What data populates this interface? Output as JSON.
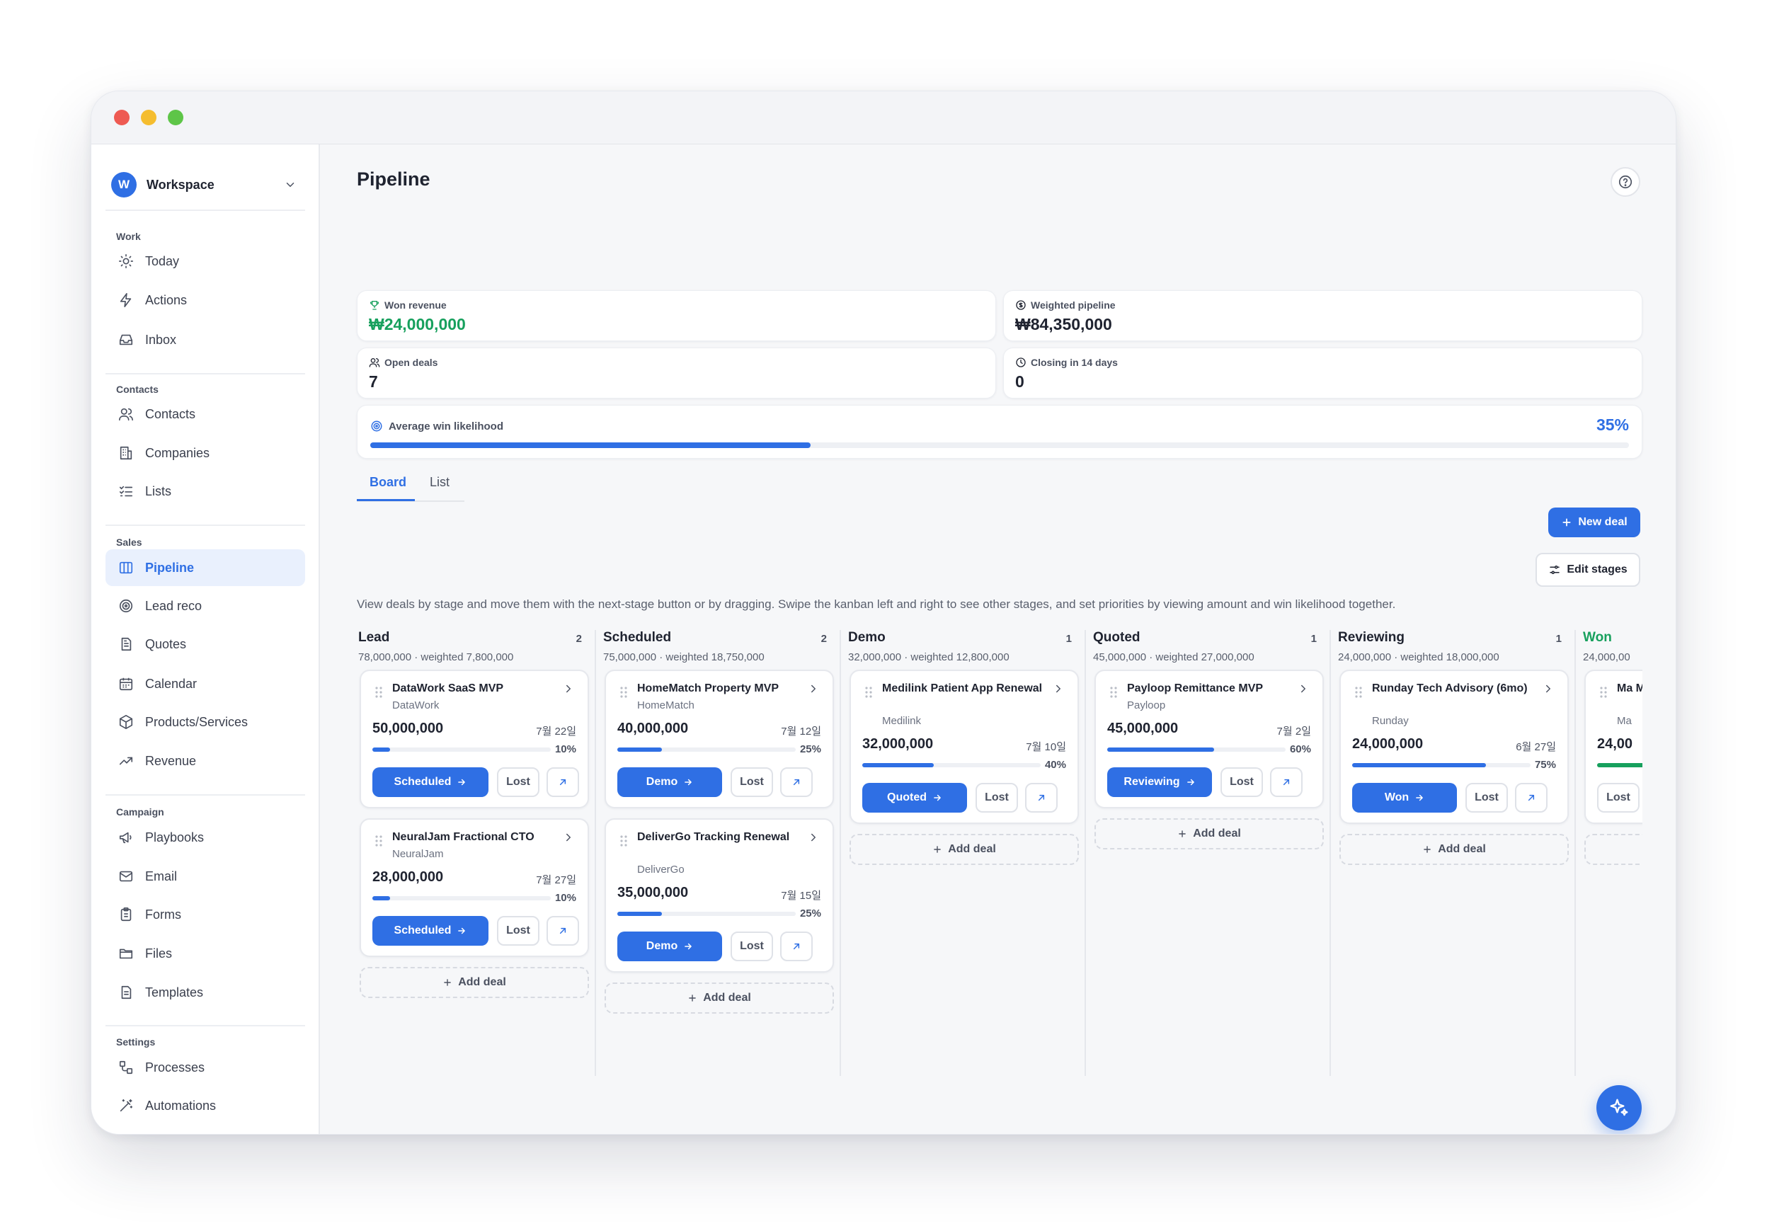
{
  "workspace": {
    "initial": "W",
    "name": "Workspace"
  },
  "sidebar": {
    "sections": {
      "work": "Work",
      "contacts": "Contacts",
      "sales": "Sales",
      "campaign": "Campaign",
      "settings": "Settings"
    },
    "items": {
      "today": "Today",
      "actions": "Actions",
      "inbox": "Inbox",
      "contacts": "Contacts",
      "companies": "Companies",
      "lists": "Lists",
      "pipeline": "Pipeline",
      "lead_reco": "Lead reco",
      "quotes": "Quotes",
      "calendar": "Calendar",
      "products": "Products/Services",
      "revenue": "Revenue",
      "playbooks": "Playbooks",
      "email": "Email",
      "forms": "Forms",
      "files": "Files",
      "templates": "Templates",
      "processes": "Processes",
      "automations": "Automations"
    }
  },
  "page": {
    "title": "Pipeline"
  },
  "stats": {
    "won_revenue": {
      "label": "Won revenue",
      "value": "₩24,000,000"
    },
    "weighted_pipeline": {
      "label": "Weighted pipeline",
      "value": "₩84,350,000"
    },
    "open_deals": {
      "label": "Open deals",
      "value": "7"
    },
    "closing": {
      "label": "Closing in 14 days",
      "value": "0"
    }
  },
  "likelihood": {
    "label": "Average win likelihood",
    "value_text": "35%",
    "value": 0.35
  },
  "tabs": {
    "board": "Board",
    "list": "List"
  },
  "actions": {
    "new_deal": "New deal",
    "edit_stages": "Edit stages"
  },
  "description": "View deals by stage and move them with the next-stage button or by dragging. Swipe the kanban left and right to see other stages, and set priorities by viewing amount and win likelihood together.",
  "common": {
    "lost": "Lost",
    "add_deal": "Add deal"
  },
  "columns": [
    {
      "name": "Lead",
      "count": "2",
      "summary": "78,000,000 · weighted 7,800,000",
      "cards": [
        {
          "title": "DataWork SaaS MVP",
          "company": "DataWork",
          "amount": "50,000,000",
          "date": "7월 22일",
          "pct_text": "10%",
          "pct": 0.1,
          "next": "Scheduled"
        },
        {
          "title": "NeuralJam Fractional CTO",
          "company": "NeuralJam",
          "amount": "28,000,000",
          "date": "7월 27일",
          "pct_text": "10%",
          "pct": 0.1,
          "next": "Scheduled"
        }
      ]
    },
    {
      "name": "Scheduled",
      "count": "2",
      "summary": "75,000,000 · weighted 18,750,000",
      "cards": [
        {
          "title": "HomeMatch Property MVP",
          "company": "HomeMatch",
          "amount": "40,000,000",
          "date": "7월 12일",
          "pct_text": "25%",
          "pct": 0.25,
          "next": "Demo"
        },
        {
          "title": "DeliverGo Tracking Renewal",
          "company": "DeliverGo",
          "amount": "35,000,000",
          "date": "7월 15일",
          "pct_text": "25%",
          "pct": 0.25,
          "next": "Demo"
        }
      ]
    },
    {
      "name": "Demo",
      "count": "1",
      "summary": "32,000,000 · weighted 12,800,000",
      "cards": [
        {
          "title": "Medilink Patient App Renewal",
          "company": "Medilink",
          "amount": "32,000,000",
          "date": "7월 10일",
          "pct_text": "40%",
          "pct": 0.4,
          "next": "Quoted"
        }
      ]
    },
    {
      "name": "Quoted",
      "count": "1",
      "summary": "45,000,000 · weighted 27,000,000",
      "cards": [
        {
          "title": "Payloop Remittance MVP",
          "company": "Payloop",
          "amount": "45,000,000",
          "date": "7월 2일",
          "pct_text": "60%",
          "pct": 0.6,
          "next": "Reviewing"
        }
      ]
    },
    {
      "name": "Reviewing",
      "count": "1",
      "summary": "24,000,000 · weighted 18,000,000",
      "cards": [
        {
          "title": "Runday Tech Advisory (6mo)",
          "company": "Runday",
          "amount": "24,000,000",
          "date": "6월 27일",
          "pct_text": "75%",
          "pct": 0.75,
          "next": "Won"
        }
      ]
    },
    {
      "name": "Won",
      "summary": "24,000,00",
      "cards": [
        {
          "title": "Ma Ma",
          "company": "Ma",
          "amount": "24,00",
          "pct": 1.0
        }
      ]
    }
  ],
  "colors": {
    "accent": "#2f6fe4",
    "success": "#17a05d",
    "text": "#1f2330"
  }
}
